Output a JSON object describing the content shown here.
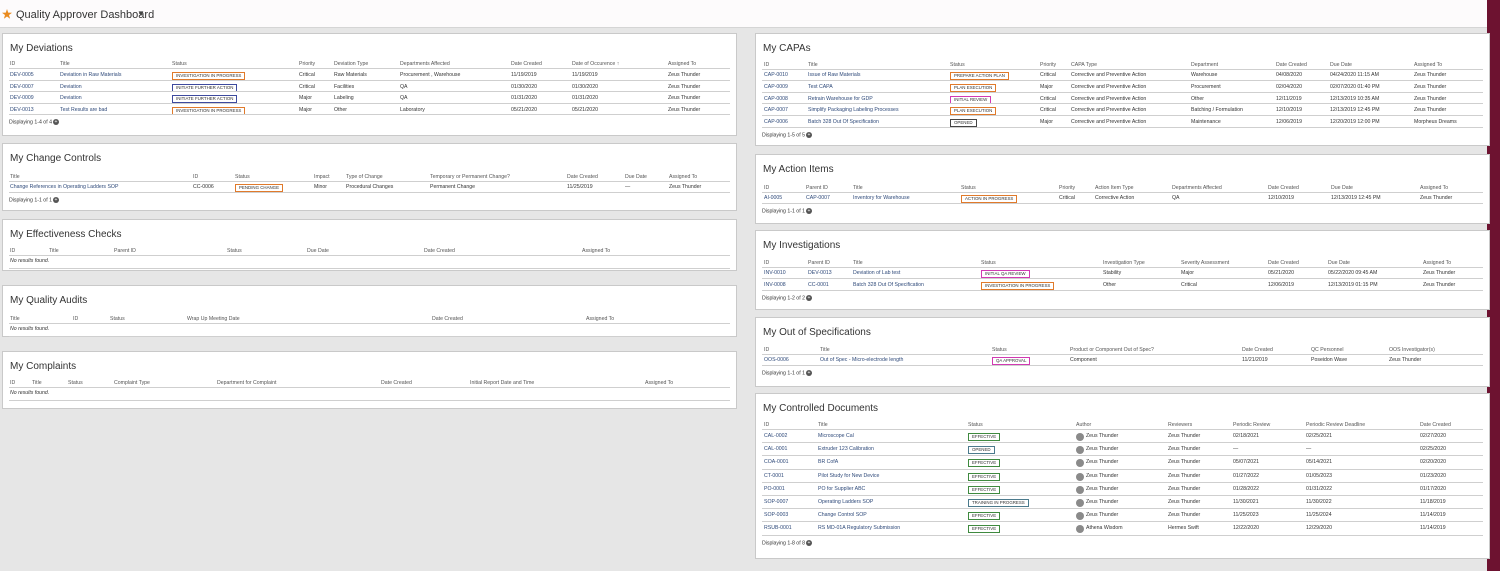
{
  "app": {
    "title": "Quality Approver Dashboard"
  },
  "deviations": {
    "title": "My Deviations",
    "headers": [
      "ID",
      "Title",
      "Status",
      "Priority",
      "Deviation Type",
      "Departments Affected",
      "Date Created",
      "Date of Occurence",
      "Assigned To"
    ],
    "rows": [
      [
        "DEV-0005",
        "Deviation in Raw Materials",
        "INVESTIGATION IN PROGRESS",
        "Critical",
        "Raw Materials",
        "Procurement , Warehouse",
        "11/19/2019",
        "11/19/2019",
        "Zeus Thunder"
      ],
      [
        "DEV-0007",
        "Deviation",
        "INITIATE FURTHER ACTION",
        "Critical",
        "Facilities",
        "QA",
        "01/30/2020",
        "01/30/2020",
        "Zeus Thunder"
      ],
      [
        "DEV-0009",
        "Deviation",
        "INITIATE FURTHER ACTION",
        "Major",
        "Labeling",
        "QA",
        "01/31/2020",
        "01/31/2020",
        "Zeus Thunder"
      ],
      [
        "DEV-0013",
        "Test Results are bad",
        "INVESTIGATION IN PROGRESS",
        "Major",
        "Other",
        "Laboratory",
        "05/21/2020",
        "05/21/2020",
        "Zeus Thunder"
      ]
    ],
    "footer": "Displaying 1-4 of 4"
  },
  "change_controls": {
    "title": "My Change Controls",
    "headers": [
      "Title",
      "ID",
      "Status",
      "Impact",
      "Type of Change",
      "Temporary or Permanent Change?",
      "Date Created",
      "Due Date",
      "Assigned To"
    ],
    "rows": [
      [
        "Change References in Operating Ladders SOP",
        "CC-0006",
        "PENDING CHANGE",
        "Minor",
        "Procedural Changes",
        "Permanent Change",
        "11/25/2019",
        "—",
        "Zeus Thunder"
      ]
    ],
    "footer": "Displaying 1-1 of 1"
  },
  "effectiveness": {
    "title": "My Effectiveness Checks",
    "headers": [
      "ID",
      "Title",
      "Parent ID",
      "Status",
      "Due Date",
      "Date Created",
      "Assigned To"
    ],
    "empty": "No results found."
  },
  "audits": {
    "title": "My Quality Audits",
    "headers": [
      "Title",
      "ID",
      "Status",
      "Wrap Up Meeting Date",
      "Date Created",
      "Assigned To"
    ],
    "empty": "No results found."
  },
  "complaints": {
    "title": "My Complaints",
    "headers": [
      "ID",
      "Title",
      "Status",
      "Complaint Type",
      "Department for Complaint",
      "Date Created",
      "Initial Report Date and Time",
      "Assigned To"
    ],
    "empty": "No results found."
  },
  "capas": {
    "title": "My CAPAs",
    "headers": [
      "ID",
      "Title",
      "Status",
      "Priority",
      "CAPA Type",
      "Department",
      "Date Created",
      "Due Date",
      "Assigned To"
    ],
    "rows": [
      [
        "CAP-0010",
        "Issue of Raw Materials",
        "PREPARE ACTION PLAN",
        "Critical",
        "Corrective and Preventive Action",
        "Warehouse",
        "04/08/2020",
        "04/24/2020 11:15 AM",
        "Zeus Thunder"
      ],
      [
        "CAP-0009",
        "Test CAPA",
        "PLAN EXECUTION",
        "Major",
        "Corrective and Preventive Action",
        "Procurement",
        "02/04/2020",
        "02/07/2020 01:40 PM",
        "Zeus Thunder"
      ],
      [
        "CAP-0008",
        "Retrain Warehouse for GDP",
        "INITIAL REVIEW",
        "Critical",
        "Corrective and Preventive Action",
        "Other",
        "12/11/2019",
        "12/13/2019 10:35 AM",
        "Zeus Thunder"
      ],
      [
        "CAP-0007",
        "Simplify Packaging Labeling Processes",
        "PLAN EXECUTION",
        "Critical",
        "Corrective and Preventive Action",
        "Batching / Formulation",
        "12/10/2019",
        "12/13/2019 12:45 PM",
        "Zeus Thunder"
      ],
      [
        "CAP-0006",
        "Batch 328 Out Of Specification",
        "OPENED",
        "Major",
        "Corrective and Preventive Action",
        "Maintenance",
        "12/06/2019",
        "12/20/2019 12:00 PM",
        "Morpheus Dreams"
      ]
    ],
    "footer": "Displaying 1-5 of 5"
  },
  "action_items": {
    "title": "My Action Items",
    "headers": [
      "ID",
      "Parent ID",
      "Title",
      "Status",
      "Priority",
      "Action Item Type",
      "Departments Affected",
      "Date Created",
      "Due Date",
      "Assigned To"
    ],
    "rows": [
      [
        "AI-0005",
        "CAP-0007",
        "Inventory for Warehouse",
        "ACTION IN PROGRESS",
        "Critical",
        "Corrective Action",
        "QA",
        "12/10/2019",
        "12/13/2019 12:45 PM",
        "Zeus Thunder"
      ]
    ],
    "footer": "Displaying 1-1 of 1"
  },
  "investigations": {
    "title": "My Investigations",
    "headers": [
      "ID",
      "Parent ID",
      "Title",
      "Status",
      "Investigation Type",
      "Severity Assessment",
      "Date Created",
      "Due Date",
      "Assigned To"
    ],
    "rows": [
      [
        "INV-0010",
        "DEV-0013",
        "Deviation of Lab test",
        "INITIAL QA REVIEW",
        "Stability",
        "Major",
        "05/21/2020",
        "05/22/2020 09:45 AM",
        "Zeus Thunder"
      ],
      [
        "INV-0008",
        "CC-0001",
        "Batch 328 Out Of Specification",
        "INVESTIGATION IN PROGRESS",
        "Other",
        "Critical",
        "12/06/2019",
        "12/13/2019 01:15 PM",
        "Zeus Thunder"
      ]
    ],
    "footer": "Displaying 1-2 of 2"
  },
  "oos": {
    "title": "My Out of Specifications",
    "headers": [
      "ID",
      "Title",
      "Status",
      "Product or Component Out of Spec?",
      "Date Created",
      "QC Personnel",
      "OOS Investigator(s)"
    ],
    "rows": [
      [
        "OOS-0006",
        "Out of Spec - Micro-electrode length",
        "QA APPROVAL",
        "Component",
        "11/21/2019",
        "Poseidon Wave",
        "Zeus Thunder"
      ]
    ],
    "footer": "Displaying 1-1 of 1"
  },
  "documents": {
    "title": "My Controlled Documents",
    "headers": [
      "ID",
      "Title",
      "Status",
      "Author",
      "Reviewers",
      "Periodic Review",
      "Periodic Review Deadline",
      "Date Created"
    ],
    "rows": [
      [
        "CAL-0002",
        "Microscope Cal",
        "EFFECTIVE",
        "Zeus Thunder",
        "Zeus Thunder",
        "02/18/2021",
        "02/25/2021",
        "02/27/2020"
      ],
      [
        "CAL-0001",
        "Extruder 123 Calibration",
        "OPENED",
        "Zeus Thunder",
        "Zeus Thunder",
        "—",
        "—",
        "02/25/2020"
      ],
      [
        "COA-0001",
        "BR CofA",
        "EFFECTIVE",
        "Zeus Thunder",
        "Zeus Thunder",
        "05/07/2021",
        "05/14/2021",
        "02/20/2020"
      ],
      [
        "CT-0001",
        "Pilot Study for New Device",
        "EFFECTIVE",
        "Zeus Thunder",
        "Zeus Thunder",
        "01/27/2022",
        "01/05/2023",
        "01/23/2020"
      ],
      [
        "PO-0001",
        "PO for Supplier ABC",
        "EFFECTIVE",
        "Zeus Thunder",
        "Zeus Thunder",
        "01/28/2022",
        "01/31/2022",
        "01/17/2020"
      ],
      [
        "SOP-0007",
        "Operating Ladders SOP",
        "TRAINING IN PROGRESS",
        "Zeus Thunder",
        "Zeus Thunder",
        "11/30/2021",
        "11/30/2022",
        "11/18/2019"
      ],
      [
        "SOP-0003",
        "Change Control SOP",
        "EFFECTIVE",
        "Zeus Thunder",
        "Zeus Thunder",
        "11/25/2023",
        "11/25/2024",
        "11/14/2019"
      ],
      [
        "RSUB-0001",
        "RS MD-01A Regulatory Submission",
        "EFFECTIVE",
        "Athena Wisdom",
        "Hermes Swift",
        "12/22/2020",
        "12/29/2020",
        "11/14/2019"
      ]
    ],
    "footer": "Displaying 1-8 of 8"
  },
  "colors": {
    "accent": "#6d1230",
    "link": "#2f4a7a",
    "star": "#e98a1e"
  },
  "icons": {
    "favorite": "star-icon",
    "sort": "sort-up-arrow-icon",
    "more": "plus-circle-icon",
    "avatar": "user-avatar-icon"
  }
}
